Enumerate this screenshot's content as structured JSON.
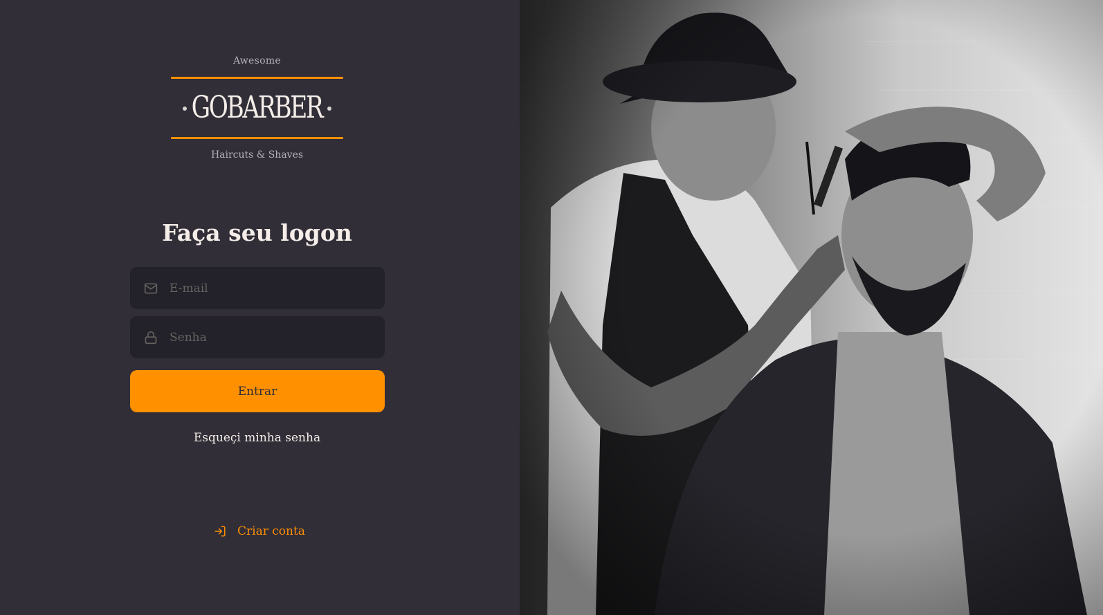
{
  "brand": {
    "tagline_top": "Awesome",
    "name": "GOBARBER",
    "tagline_bottom": "Haircuts & Shaves"
  },
  "form": {
    "title": "Faça seu logon",
    "email": {
      "placeholder": "E-mail",
      "value": "",
      "icon": "mail-icon"
    },
    "password": {
      "placeholder": "Senha",
      "value": "",
      "icon": "lock-icon"
    },
    "submit_label": "Entrar",
    "forgot_label": "Esqueçi minha senha"
  },
  "create_account": {
    "label": "Criar conta",
    "icon": "log-in-icon"
  },
  "colors": {
    "background": "#312e38",
    "input_background": "#232129",
    "accent": "#ff9000",
    "text": "#f4ede8",
    "placeholder": "#666360"
  }
}
